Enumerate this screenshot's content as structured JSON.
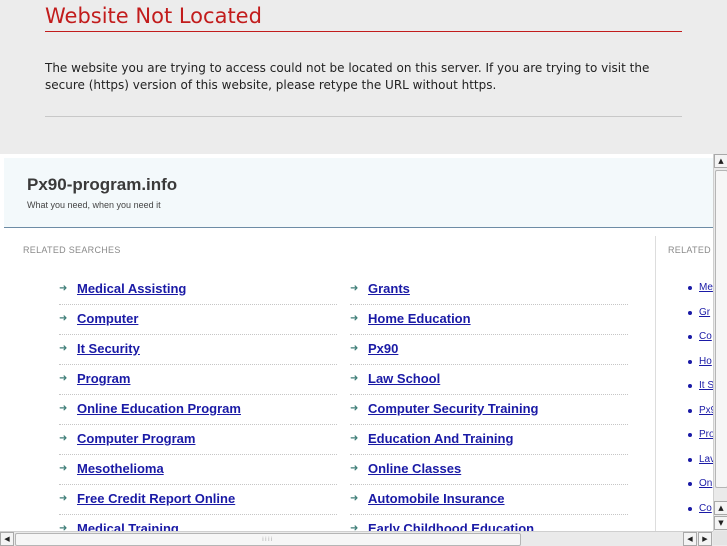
{
  "error": {
    "title": "Website Not Located",
    "message": "The website you are trying to access could not be located on this server. If you are trying to visit the secure (https) version of this website, please retype the URL without https."
  },
  "site": {
    "name": "Px90-program.info",
    "tagline": "What you need, when you need it"
  },
  "related": {
    "label": "RELATED SEARCHES",
    "left": [
      "Medical Assisting",
      "Computer",
      "It Security",
      "Program",
      "Online Education Program",
      "Computer Program",
      "Mesothelioma",
      "Free Credit Report Online",
      "Medical Training"
    ],
    "right": [
      "Grants",
      "Home Education",
      "Px90",
      "Law School",
      "Computer Security Training",
      "Education And Training",
      "Online Classes",
      "Automobile Insurance",
      "Early Childhood Education"
    ]
  },
  "sidebar": {
    "label": "RELATED",
    "items": [
      "Me",
      "Gr",
      "Co",
      "Ho",
      "It S",
      "Px9",
      "Pro",
      "Lav",
      "On",
      "Co"
    ]
  },
  "icons": {
    "arrow": "arrow-right-icon",
    "scroll_up": "scroll-up-icon",
    "scroll_down": "scroll-down-icon",
    "scroll_left": "scroll-left-icon",
    "scroll_right": "scroll-right-icon"
  },
  "colors": {
    "error_red": "#c21c1c",
    "link_blue": "#1a1aa6",
    "arrow_teal": "#3f7e78",
    "header_bg": "#f3f9fb"
  }
}
